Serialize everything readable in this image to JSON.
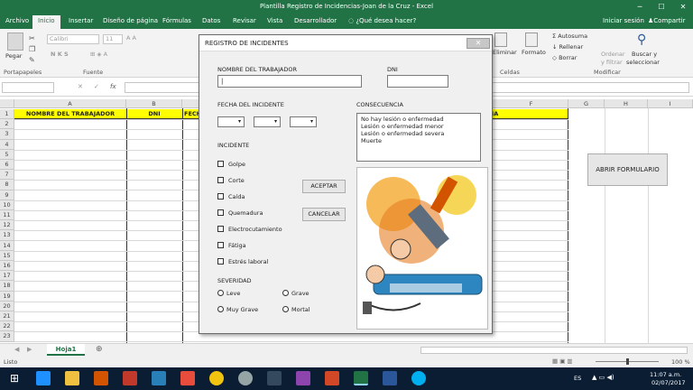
{
  "window": {
    "title": "Plantilla Registro de Incidencias-Joan de la Cruz - Excel",
    "minimize": "─",
    "maximize": "☐",
    "close": "✕"
  },
  "ribbon_tabs": {
    "archivo": "Archivo",
    "inicio": "Inicio",
    "insertar": "Insertar",
    "diseno": "Diseño de página",
    "formulas": "Fórmulas",
    "datos": "Datos",
    "revisar": "Revisar",
    "vista": "Vista",
    "desarrollador": "Desarrollador",
    "tell": "¿Qué desea hacer?",
    "signin": "Iniciar sesión",
    "share": "Compartir"
  },
  "ribbon": {
    "pegar": "Pegar",
    "portapapeles": "Portapapeles",
    "font_name": "Calibri",
    "font_size": "11",
    "fuente": "Fuente",
    "nks": "N  K  S",
    "celdas": "Celdas",
    "eliminar": "Eliminar",
    "formato": "Formato",
    "autosuma": "Autosuma",
    "rellenar": "Rellenar",
    "borrar": "Borrar",
    "ordenar": "Ordenar",
    "filtrar": "y filtrar",
    "buscar": "Buscar y",
    "seleccionar": "seleccionar",
    "modificar": "Modificar"
  },
  "formula_bar": {
    "namebox": "",
    "fx": "fx",
    "x": "✕",
    "check": "✓"
  },
  "grid": {
    "columns": [
      "A",
      "B",
      "F",
      "G",
      "H",
      "I"
    ],
    "rows": [
      "1",
      "2",
      "3",
      "4",
      "5",
      "6",
      "7",
      "8",
      "9",
      "10",
      "11",
      "12",
      "13",
      "14",
      "15",
      "16",
      "17",
      "18",
      "19",
      "20",
      "21",
      "22",
      "23"
    ],
    "header_A": "NOMBRE DEL TRABAJADOR",
    "header_B": "DNI",
    "header_C": "FECH",
    "header_E": "CIA"
  },
  "abrir_button": "ABRIR FORMULARIO",
  "sheet_tab": "Hoja1",
  "status": {
    "ready": "Listo",
    "zoom": "100 %"
  },
  "taskbar": {
    "lang": "ES",
    "time": "11:07 a.m.",
    "date": "02/07/2017"
  },
  "dialog": {
    "title": "REGISTRO DE INCIDENTES",
    "close": "✕",
    "nombre_label": "NOMBRE DEL TRABAJADOR",
    "nombre_value": "|",
    "dni_label": "DNI",
    "dni_value": "",
    "fecha_label": "FECHA DEL INCIDENTE",
    "consecuencia_label": "CONSECUENCIA",
    "consecuencias": [
      "No hay lesión o enfermedad",
      "Lesión o enfermedad menor",
      "Lesión o enfermedad severa",
      "Muerte"
    ],
    "incidente_label": "INCIDENTE",
    "incidentes": [
      "Golpe",
      "Corte",
      "Caída",
      "Quemadura",
      "Electrocutamiento",
      "Fátiga",
      "Estrés laboral"
    ],
    "aceptar": "ACEPTAR",
    "cancelar": "CANCELAR",
    "severidad_label": "SEVERIDAD",
    "severidades": [
      "Leve",
      "Grave",
      "Muy Grave",
      "Mortal"
    ]
  },
  "colors": {
    "excel_green": "#217346",
    "header_yellow": "#ffff00",
    "taskbar": "#0b1d33"
  }
}
